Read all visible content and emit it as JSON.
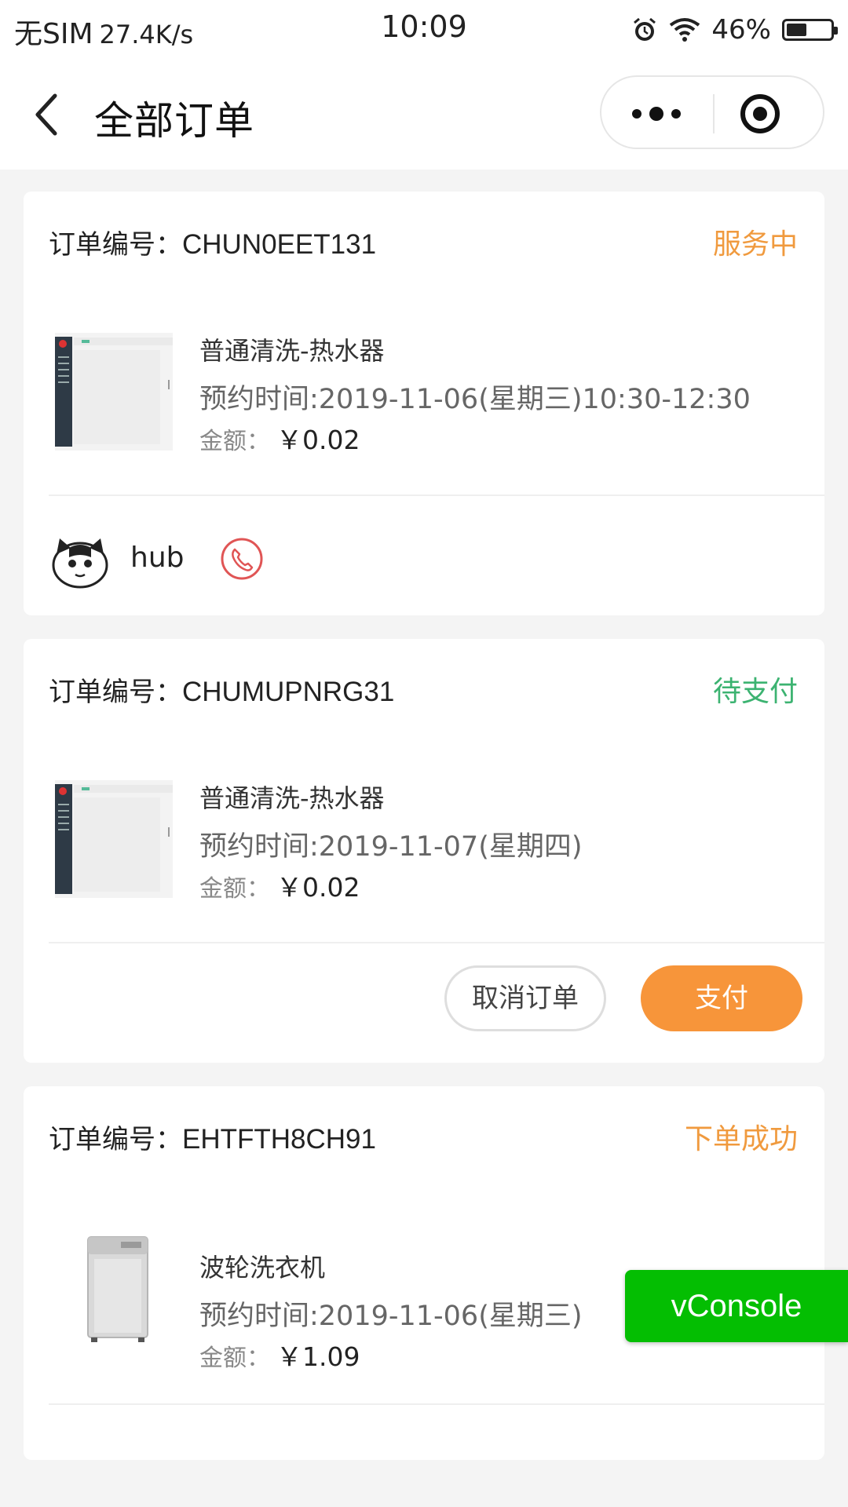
{
  "status_bar": {
    "carrier": "无SIM",
    "net_speed": "27.4K/s",
    "time": "10:09",
    "battery": "46%",
    "battery_level": 0.46,
    "icons": [
      "alarm-icon",
      "wifi-icon",
      "battery-icon"
    ]
  },
  "nav": {
    "title": "全部订单",
    "icons": [
      "back-arrow-icon",
      "more-dots-icon",
      "target-close-icon"
    ]
  },
  "orders": [
    {
      "label": "订单编号：",
      "number": "CHUN0EET131",
      "status": "服务中",
      "status_color": "#f09a3e",
      "item_name": "普通清洗-热水器",
      "appointment": "预约时间:2019-11-06(星期三)10:30-12:30",
      "amount_label": "金额：",
      "amount": "￥0.02",
      "user_name": "hub"
    },
    {
      "label": "订单编号：",
      "number": "CHUMUPNRG31",
      "status": "待支付",
      "status_color": "#3cb371",
      "item_name": "普通清洗-热水器",
      "appointment": "预约时间:2019-11-07(星期四)",
      "amount_label": "金额：",
      "amount": "￥0.02",
      "cancel_label": "取消订单",
      "pay_label": "支付"
    },
    {
      "label": "订单编号：",
      "number": "EHTFTH8CH91",
      "status": "下单成功",
      "status_color": "#f09a3e",
      "item_name": "波轮洗衣机",
      "appointment": "预约时间:2019-11-06(星期三)",
      "amount_label": "金额：",
      "amount": "￥1.09"
    }
  ],
  "vconsole": {
    "label": "vConsole",
    "color": "#04be02"
  },
  "colors": {
    "accent_orange": "#f7953a",
    "phone_red": "#e05555",
    "background": "#f4f4f4"
  }
}
